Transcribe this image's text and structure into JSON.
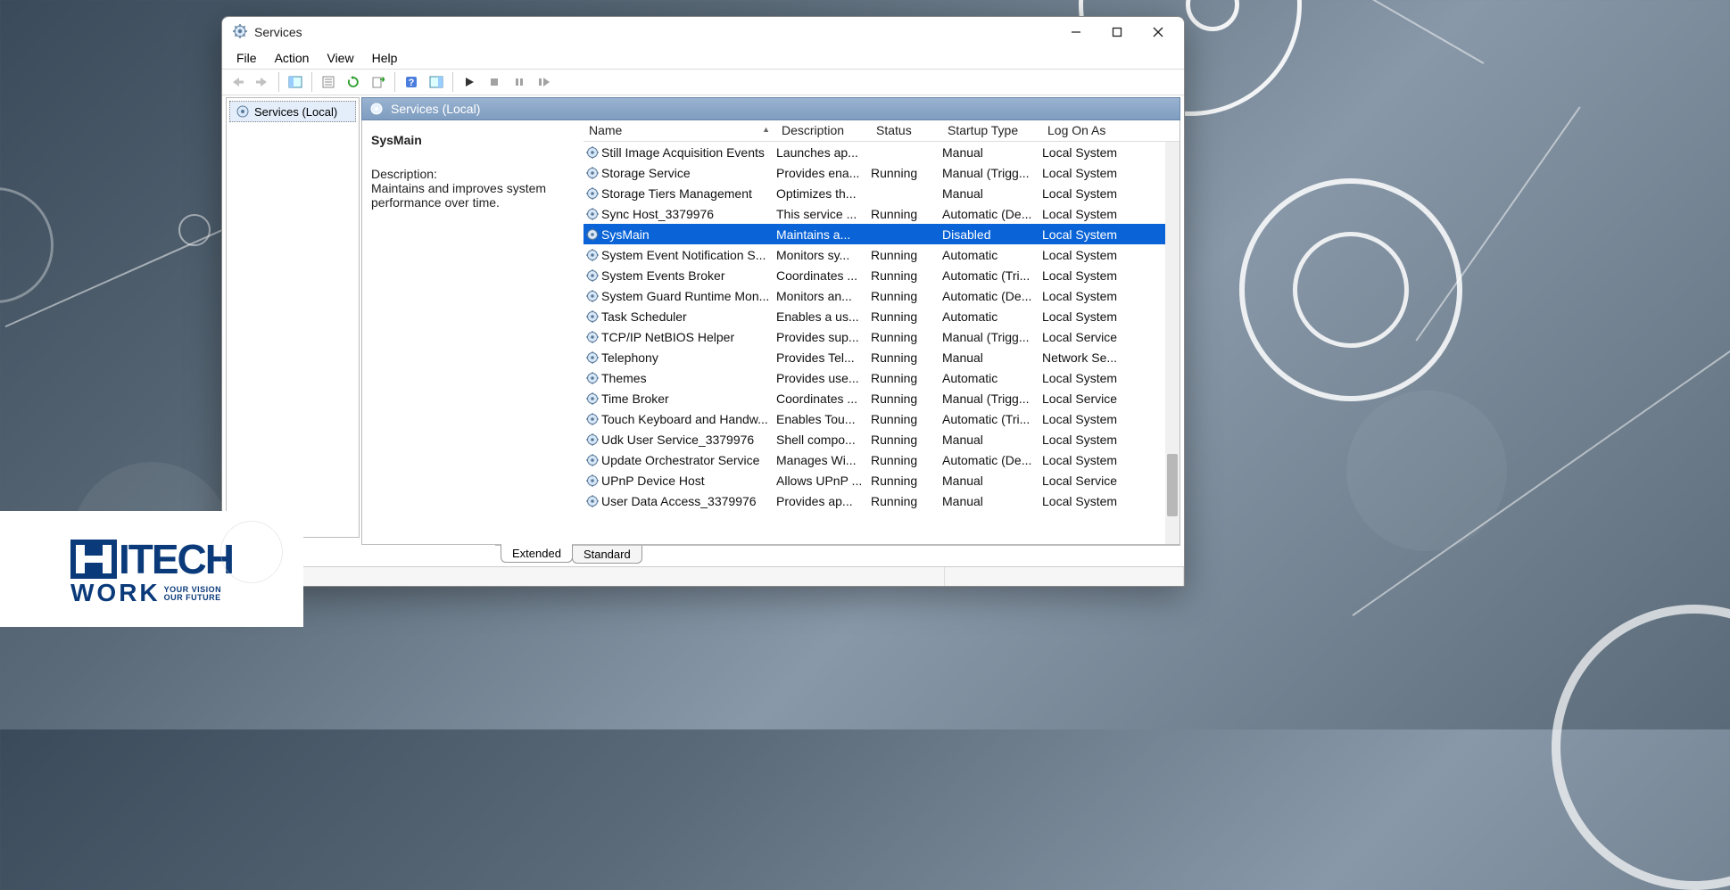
{
  "window": {
    "title": "Services"
  },
  "menu": {
    "file": "File",
    "action": "Action",
    "view": "View",
    "help": "Help"
  },
  "tree": {
    "root": "Services (Local)"
  },
  "panel": {
    "header": "Services (Local)"
  },
  "detail": {
    "selected_name": "SysMain",
    "description_label": "Description:",
    "description_text": "Maintains and improves system performance over time."
  },
  "columns": {
    "name": "Name",
    "description": "Description",
    "status": "Status",
    "startup": "Startup Type",
    "logon": "Log On As"
  },
  "services": [
    {
      "name": "Still Image Acquisition Events",
      "desc": "Launches ap...",
      "status": "",
      "startup": "Manual",
      "logon": "Local System",
      "selected": false
    },
    {
      "name": "Storage Service",
      "desc": "Provides ena...",
      "status": "Running",
      "startup": "Manual (Trigg...",
      "logon": "Local System",
      "selected": false
    },
    {
      "name": "Storage Tiers Management",
      "desc": "Optimizes th...",
      "status": "",
      "startup": "Manual",
      "logon": "Local System",
      "selected": false
    },
    {
      "name": "Sync Host_3379976",
      "desc": "This service ...",
      "status": "Running",
      "startup": "Automatic (De...",
      "logon": "Local System",
      "selected": false
    },
    {
      "name": "SysMain",
      "desc": "Maintains a...",
      "status": "",
      "startup": "Disabled",
      "logon": "Local System",
      "selected": true
    },
    {
      "name": "System Event Notification S...",
      "desc": "Monitors sy...",
      "status": "Running",
      "startup": "Automatic",
      "logon": "Local System",
      "selected": false
    },
    {
      "name": "System Events Broker",
      "desc": "Coordinates ...",
      "status": "Running",
      "startup": "Automatic (Tri...",
      "logon": "Local System",
      "selected": false
    },
    {
      "name": "System Guard Runtime Mon...",
      "desc": "Monitors an...",
      "status": "Running",
      "startup": "Automatic (De...",
      "logon": "Local System",
      "selected": false
    },
    {
      "name": "Task Scheduler",
      "desc": "Enables a us...",
      "status": "Running",
      "startup": "Automatic",
      "logon": "Local System",
      "selected": false
    },
    {
      "name": "TCP/IP NetBIOS Helper",
      "desc": "Provides sup...",
      "status": "Running",
      "startup": "Manual (Trigg...",
      "logon": "Local Service",
      "selected": false
    },
    {
      "name": "Telephony",
      "desc": "Provides Tel...",
      "status": "Running",
      "startup": "Manual",
      "logon": "Network Se...",
      "selected": false
    },
    {
      "name": "Themes",
      "desc": "Provides use...",
      "status": "Running",
      "startup": "Automatic",
      "logon": "Local System",
      "selected": false
    },
    {
      "name": "Time Broker",
      "desc": "Coordinates ...",
      "status": "Running",
      "startup": "Manual (Trigg...",
      "logon": "Local Service",
      "selected": false
    },
    {
      "name": "Touch Keyboard and Handw...",
      "desc": "Enables Tou...",
      "status": "Running",
      "startup": "Automatic (Tri...",
      "logon": "Local System",
      "selected": false
    },
    {
      "name": "Udk User Service_3379976",
      "desc": "Shell compo...",
      "status": "Running",
      "startup": "Manual",
      "logon": "Local System",
      "selected": false
    },
    {
      "name": "Update Orchestrator Service",
      "desc": "Manages Wi...",
      "status": "Running",
      "startup": "Automatic (De...",
      "logon": "Local System",
      "selected": false
    },
    {
      "name": "UPnP Device Host",
      "desc": "Allows UPnP ...",
      "status": "Running",
      "startup": "Manual",
      "logon": "Local Service",
      "selected": false
    },
    {
      "name": "User Data Access_3379976",
      "desc": "Provides ap...",
      "status": "Running",
      "startup": "Manual",
      "logon": "Local System",
      "selected": false
    }
  ],
  "tabs": {
    "extended": "Extended",
    "standard": "Standard"
  },
  "logo": {
    "top": "ITECH",
    "bot": "WORK",
    "tag1": "YOUR VISION",
    "tag2": "OUR FUTURE"
  }
}
